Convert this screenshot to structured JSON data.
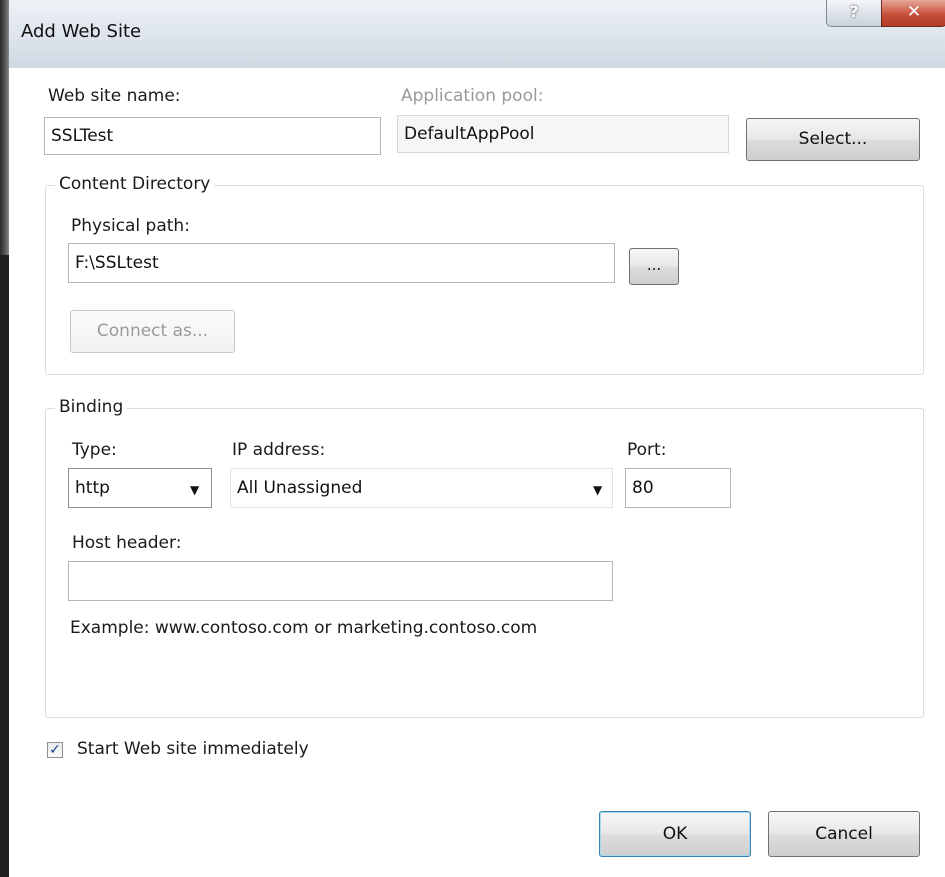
{
  "window": {
    "title": "Add Web Site",
    "help_glyph": "?",
    "close_glyph": "✕"
  },
  "site": {
    "name_label": "Web site name:",
    "name_value": "SSLTest",
    "app_pool_label": "Application pool:",
    "app_pool_value": "DefaultAppPool",
    "select_button": "Select..."
  },
  "content_directory": {
    "group_title": "Content Directory",
    "physical_path_label": "Physical path:",
    "physical_path_value": "F:\\SSLtest",
    "browse_button": "...",
    "connect_as_button": "Connect as..."
  },
  "binding": {
    "group_title": "Binding",
    "type_label": "Type:",
    "type_value": "http",
    "ip_label": "IP address:",
    "ip_value": "All Unassigned",
    "port_label": "Port:",
    "port_value": "80",
    "host_header_label": "Host header:",
    "host_header_value": "",
    "example_text": "Example: www.contoso.com or marketing.contoso.com"
  },
  "options": {
    "start_immediately_label": "Start Web site immediately",
    "start_immediately_checked": true
  },
  "footer": {
    "ok_button": "OK",
    "cancel_button": "Cancel"
  },
  "colors": {
    "title_gradient_top": "#eef2f6",
    "close_red": "#c7503a",
    "default_button_border": "#3c7fb1"
  }
}
